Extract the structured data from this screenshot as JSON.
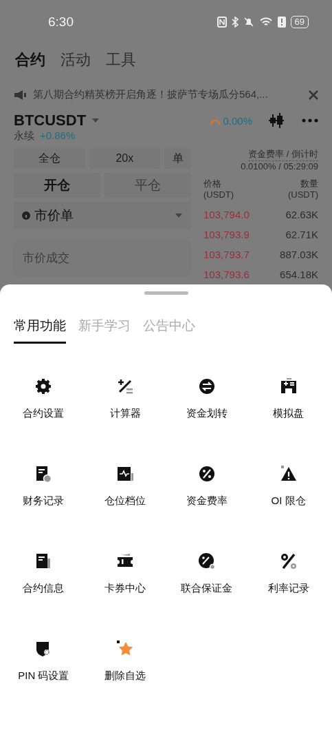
{
  "status_bar": {
    "time": "6:30",
    "battery": "69"
  },
  "header_tabs": [
    {
      "label": "合约",
      "selected": true
    },
    {
      "label": "活动",
      "selected": false
    },
    {
      "label": "工具",
      "selected": false
    }
  ],
  "announcement": {
    "text": "第八期合约精英榜开启角逐！披萨节专场瓜分564,..."
  },
  "ticker": {
    "symbol": "BTCUSDT",
    "type": "永续",
    "change": "+0.86%",
    "indicator": "0.00%"
  },
  "order_panel": {
    "margin_mode": "全仓",
    "leverage": "20x",
    "position_mode": "单",
    "order_type": "市价单",
    "price_placeholder": "市价成交",
    "actions": [
      {
        "label": "开仓",
        "selected": true
      },
      {
        "label": "平仓",
        "selected": false
      }
    ]
  },
  "funding": {
    "label": "资金费率 / 倒计时",
    "value": "0.0100% / 05:29:09"
  },
  "order_book": {
    "columns": [
      {
        "title": "价格",
        "unit": "(USDT)"
      },
      {
        "title": "数量",
        "unit": "(USDT)"
      }
    ],
    "rows": [
      {
        "price": "103,794.0",
        "amount": "62.63K"
      },
      {
        "price": "103,793.9",
        "amount": "62.71K"
      },
      {
        "price": "103,793.7",
        "amount": "887.03K"
      },
      {
        "price": "103,793.6",
        "amount": "654.18K"
      }
    ]
  },
  "sheet": {
    "tabs": [
      {
        "label": "常用功能",
        "selected": true
      },
      {
        "label": "新手学习",
        "selected": false
      },
      {
        "label": "公告中心",
        "selected": false
      }
    ],
    "items": [
      {
        "label": "合约设置"
      },
      {
        "label": "计算器"
      },
      {
        "label": "资金划转"
      },
      {
        "label": "模拟盘"
      },
      {
        "label": "财务记录"
      },
      {
        "label": "仓位档位"
      },
      {
        "label": "资金费率"
      },
      {
        "label": "OI 限仓"
      },
      {
        "label": "合约信息"
      },
      {
        "label": "卡券中心"
      },
      {
        "label": "联合保证金"
      },
      {
        "label": "利率记录"
      },
      {
        "label": "PIN 码设置"
      },
      {
        "label": "删除自选"
      }
    ]
  }
}
